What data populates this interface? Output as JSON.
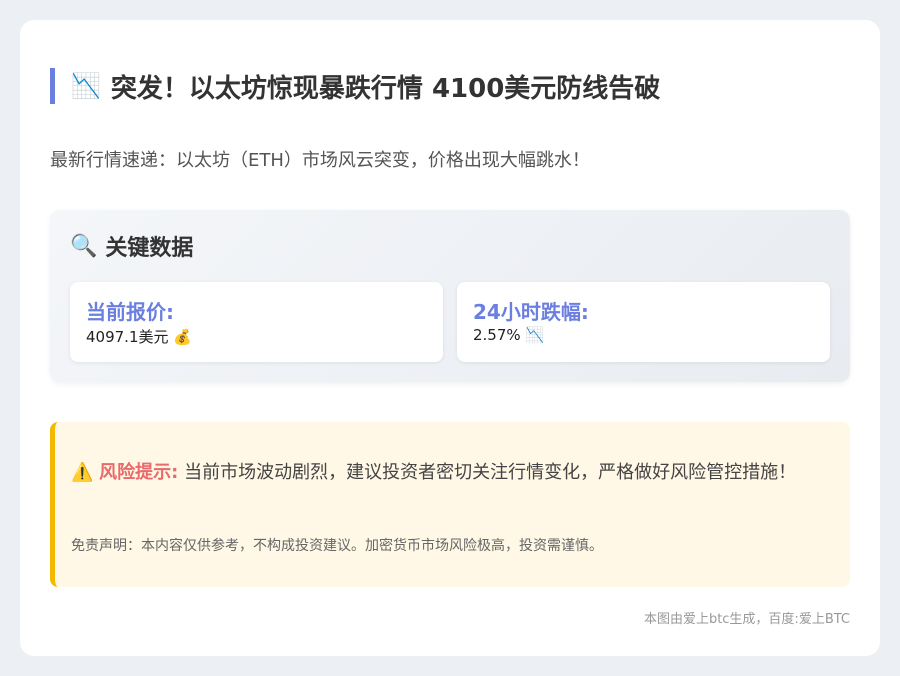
{
  "title": {
    "icon": "chart-down-icon",
    "icon_glyph": "📉",
    "text": "突发！以太坊惊现暴跌行情 4100美元防线告破"
  },
  "intro": "最新行情速递：以太坊（ETH）市场风云突变，价格出现大幅跳水！",
  "key_data": {
    "icon": "magnifier-icon",
    "icon_glyph": "🔍",
    "heading": "关键数据",
    "price": {
      "label": "当前报价:",
      "value": "4097.1美元",
      "icon": "money-bag-icon",
      "icon_glyph": "💰"
    },
    "change": {
      "label": "24小时跌幅:",
      "value": "2.57%",
      "icon": "chart-down-icon",
      "icon_glyph": "📉"
    }
  },
  "risk": {
    "icon": "warning-icon",
    "icon_glyph": "⚠️",
    "label": "风险提示:",
    "text": "当前市场波动剧烈，建议投资者密切关注行情变化，严格做好风险管控措施！",
    "disclaimer": "免责声明：本内容仅供参考，不构成投资建议。加密货币市场风险极高，投资需谨慎。"
  },
  "footer": "本图由爱上btc生成，百度:爱上BTC",
  "colors": {
    "accent": "#6b7fe0",
    "risk_border": "#f5b800",
    "risk_label": "#e86a6a",
    "risk_bg": "#fff8e6"
  }
}
